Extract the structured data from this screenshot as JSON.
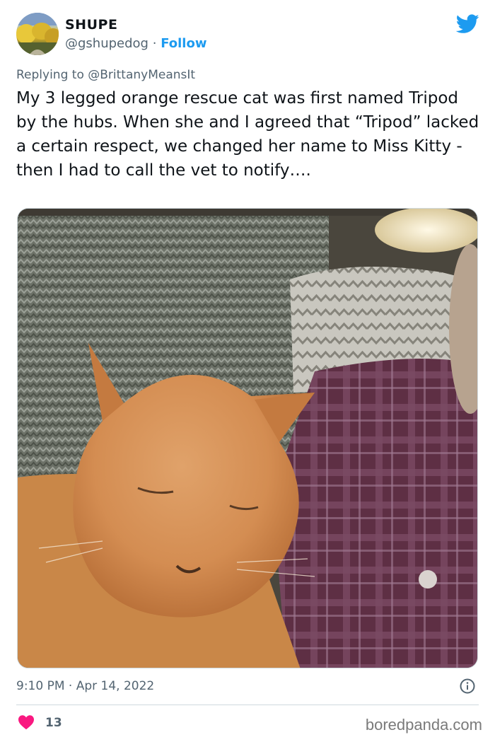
{
  "author": {
    "display_name": "SHUPE",
    "handle": "@gshupedog",
    "separator": "·",
    "follow_label": "Follow"
  },
  "reply": {
    "prefix": "Replying to",
    "mention": "@BrittanyMeansIt"
  },
  "tweet": {
    "text": "My 3 legged orange rescue cat was first named Tripod by the hubs. When she and I agreed that “Tripod” lacked a certain respect, we changed her name to Miss Kitty - then I had to call the vet to notify…."
  },
  "meta": {
    "time": "9:10 PM",
    "separator": "·",
    "date": "Apr 14, 2022"
  },
  "engagement": {
    "likes": "13"
  },
  "watermark": "boredpanda.com",
  "icons": {
    "brand": "twitter-bird-icon",
    "info": "info-icon",
    "like": "heart-icon"
  },
  "colors": {
    "accent": "#1d9bf0",
    "like": "#f91880",
    "secondary_text": "#536471",
    "primary_text": "#0f1419"
  }
}
